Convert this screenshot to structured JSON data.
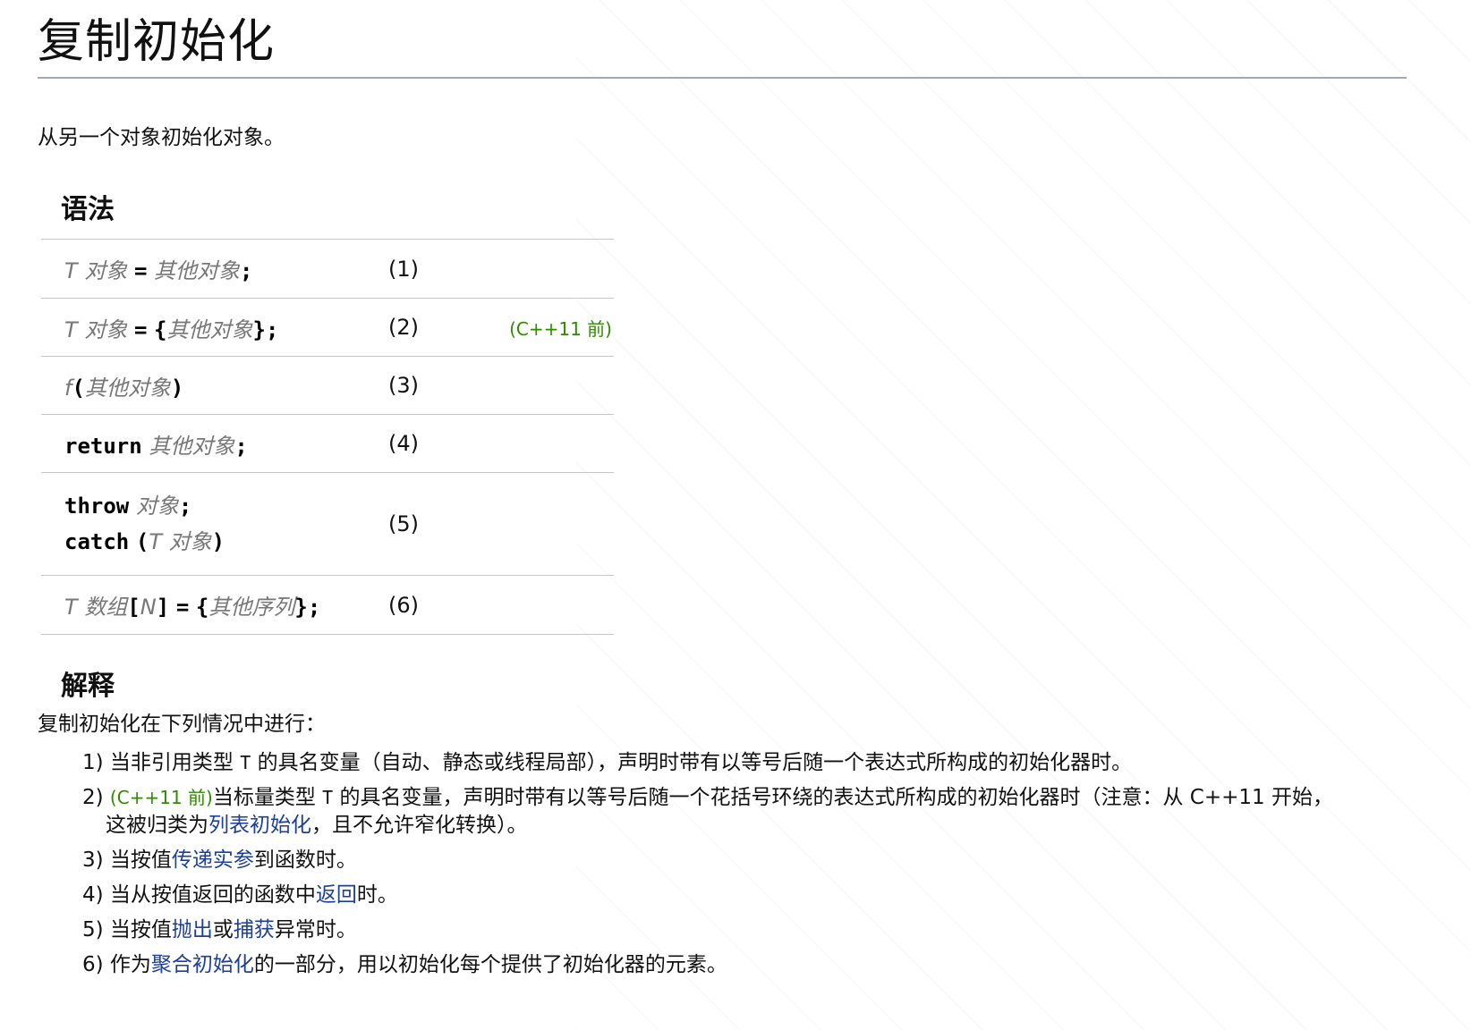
{
  "title": "复制初始化",
  "intro": "从另一个对象初始化对象。",
  "syntax_heading": "语法",
  "syntax_rows": [
    {
      "number": "(1)"
    },
    {
      "number": "(2)",
      "version": "(C++11 前)"
    },
    {
      "number": "(3)"
    },
    {
      "number": "(4)"
    },
    {
      "number": "(5)"
    },
    {
      "number": "(6)"
    }
  ],
  "code": {
    "T": "T",
    "obj": "对象",
    "other": "其他对象",
    "eq": "=",
    "semi": ";",
    "lbrace": "{",
    "rbrace": "}",
    "f": "f",
    "lparen": "(",
    "rparen": ")",
    "return_kw": "return",
    "throw_kw": "throw",
    "catch_kw": "catch",
    "array": "数组",
    "N": "N",
    "other_seq": "其他序列"
  },
  "explanation_heading": "解释",
  "explanation_intro": "复制初始化在下列情况中进行：",
  "items": {
    "i1_num": "1)",
    "i1_a": "当非引用类型",
    "i1_T": "T",
    "i1_b": "的具名变量（自动、静态或线程局部），声明时带有以等号后随一个表达式所构成的初始化器时。",
    "i2_num": "2)",
    "i2_ver": "(C++11 前)",
    "i2_a": "当标量类型",
    "i2_T": "T",
    "i2_b": "的具名变量，声明时带有以等号后随一个花括号环绕的表达式所构成的初始化器时（注意：从 C++11 开始，这被归类为",
    "i2_link": "列表初始化",
    "i2_c": "，且不允许窄化转换）。",
    "i3_num": "3)",
    "i3_a": "当按值",
    "i3_link": "传递实参",
    "i3_b": "到函数时。",
    "i4_num": "4)",
    "i4_a": "当从按值返回的函数中",
    "i4_link": "返回",
    "i4_b": "时。",
    "i5_num": "5)",
    "i5_a": "当按值",
    "i5_link1": "抛出",
    "i5_b": "或",
    "i5_link2": "捕获",
    "i5_c": "异常时。",
    "i6_num": "6)",
    "i6_a": "作为",
    "i6_link": "聚合初始化",
    "i6_b": "的一部分，用以初始化每个提供了初始化器的元素。"
  }
}
